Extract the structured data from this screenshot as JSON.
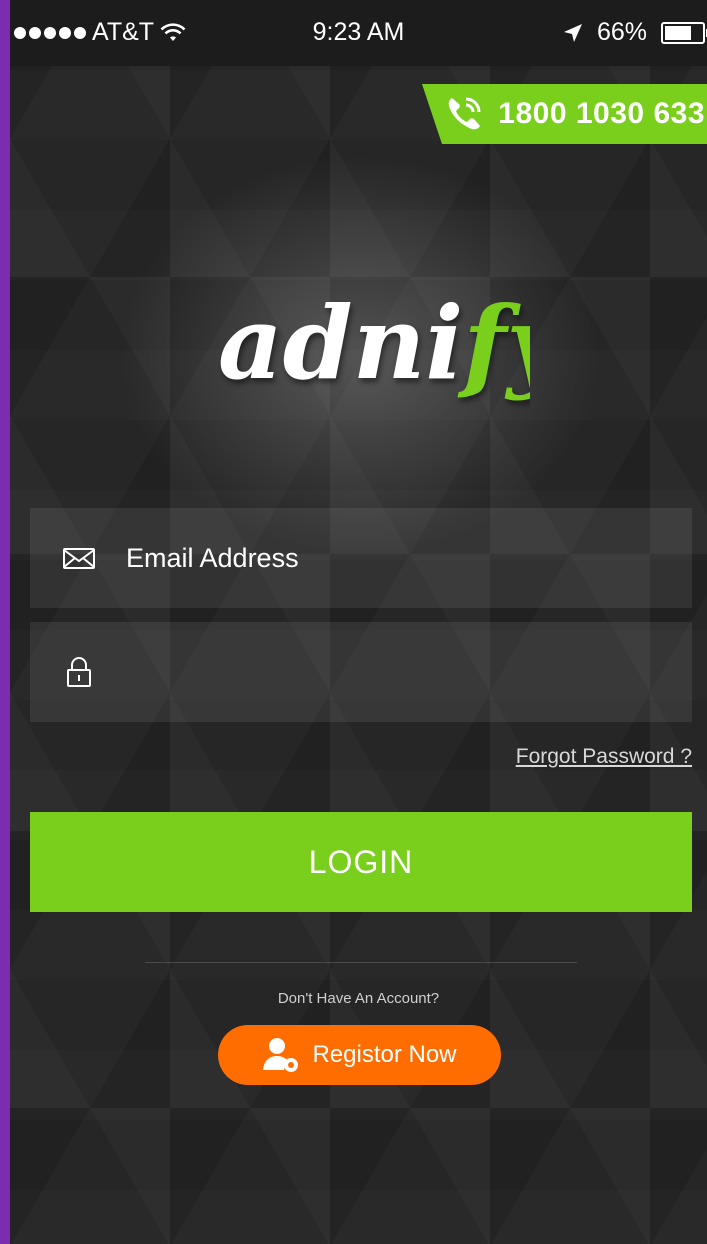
{
  "status_bar": {
    "carrier": "AT&T",
    "time": "9:23 AM",
    "battery": "66%",
    "battery_level": 0.66,
    "icons": [
      "signal-dots-icon",
      "wifi-icon",
      "location-arrow-icon",
      "battery-icon"
    ]
  },
  "header": {
    "phone_number": "1800 1030 633",
    "phone_icon": "phone-icon"
  },
  "logo": {
    "part1": "adni",
    "part2": "fy",
    "part1_color": "#ffffff",
    "part2_color": "#79cf1c"
  },
  "login_form": {
    "email_placeholder": "Email Address",
    "email_icon": "mail-icon",
    "password_placeholder": "",
    "password_icon": "lock-icon",
    "forgot_label": "Forgot Password ?",
    "login_label": "LOGIN"
  },
  "register": {
    "prompt": "Don't Have An Account?",
    "button_label": "Registor Now",
    "button_icon": "user-settings-icon"
  },
  "colors": {
    "accent": "#79cf1c",
    "register": "#ff6d00",
    "background": "#262626",
    "frame": "#7b2cb0"
  }
}
